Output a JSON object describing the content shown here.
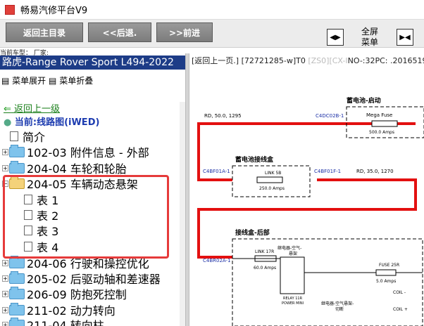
{
  "window": {
    "title": "畅易汽修平台V9"
  },
  "toolbar": {
    "home": "返回主目录",
    "back": "<<后退.",
    "forward": ">>前进",
    "fullscreen_line1": "全屏",
    "fullscreen_line2": "菜单"
  },
  "sidebar": {
    "vehicle_label": "当前车型：  厂家:",
    "vehicle": "路虎-Range Rover Sport L494-2022",
    "menu_expand": "菜单展开",
    "menu_collapse": "菜单折叠",
    "back_up": "返回上一级",
    "current": "当前:线路图(iWED)",
    "tree": [
      "简介",
      "102-03 附件信息 - 外部",
      "204-04 车轮和轮胎",
      "204-05 车辆动态悬架",
      "表 1",
      "表 2",
      "表 3",
      "表 4",
      "204-06 行驶和操控优化",
      "205-02 后驱动轴和差速器",
      "206-09 防抱死控制",
      "211-02 动力转向",
      "211-04 转向柱"
    ]
  },
  "content": {
    "path_a": "[返回上一页.]",
    "path_b": " [72721285-w]T0 ",
    "path_c": "[ZS0][CX-I",
    "path_d": "NO-:32PC: .20165192"
  },
  "diagram": {
    "title_battery": "蓄电池-启动",
    "battery_wire": "RD, 50.0, 1295",
    "conn_c4dc02b": "C4DC02B-1",
    "mega_fuse": "Mega Fuse",
    "mega_fuse_amps": "500.0 Amps",
    "title_junction": "蓄电池接线盒",
    "conn_c4bf01a": "C4BF01A-1",
    "link5b": "LINK 5B",
    "link5b_amps": "250.0 Amps",
    "conn_c4bf01f": "C4BF01F-1",
    "wire2": "RD, 35.0, 1270",
    "title_rear": "接线盒-后部",
    "conn_c4br02a": "C4BR02A-1",
    "relay_air": "继电器-空气-",
    "relay_air2": "悬架",
    "link17r": "LINK 17R",
    "link17r_amps": "60.0 Amps",
    "relay11r": "RELAY 11R",
    "power_mini": "POWER MINI",
    "fuse25r": "FUSE 25R",
    "fuse25r_amps": "5.0 Amps",
    "coil_minus": "COIL -",
    "coil_plus": "COIL +",
    "relay_cut1": "继电器-空气悬架-",
    "relay_cut2": "切断"
  }
}
